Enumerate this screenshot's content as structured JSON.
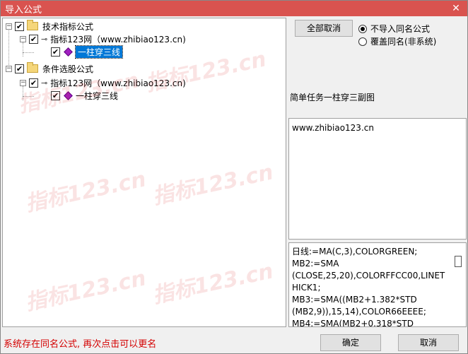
{
  "window": {
    "title": "导入公式",
    "close_glyph": "✕"
  },
  "tree": {
    "cat1": {
      "label": "技术指标公式",
      "expander": "−",
      "check": "✔"
    },
    "cat1_source": {
      "label": "指标123网（www.zhibiao123.cn)",
      "expander": "−",
      "check": "✔"
    },
    "cat1_item": {
      "label": "一柱穿三线",
      "check": "✔",
      "selected": true
    },
    "cat2": {
      "label": "条件选股公式",
      "expander": "−",
      "check": "✔"
    },
    "cat2_source": {
      "label": "指标123网（www.zhibiao123.cn)",
      "expander": "−",
      "check": "✔"
    },
    "cat2_item": {
      "label": "一柱穿三线",
      "check": "✔"
    }
  },
  "buttons": {
    "cancel_all": "全部取消",
    "ok": "确定",
    "cancel": "取消"
  },
  "options": [
    {
      "label": "不导入同名公式",
      "selected": true
    },
    {
      "label": "覆盖同名(非系统)",
      "selected": false
    }
  ],
  "description": "简单任务一柱穿三副图",
  "url_text": "www.zhibiao123.cn",
  "code_lines": [
    "日线:=MA(C,3),COLORGREEN;",
    "MB2:=SMA",
    "(CLOSE,25,20),COLORFFCC00,LINETHICK1;",
    "MB3:=SMA((MB2+1.382*STD",
    "(MB2,9)),15,14),COLOR66EEEE;",
    "MB4:=SMA(MB2+0.318*STD"
  ],
  "status_text": "系统存在同名公式, 再次点击可以更名",
  "watermark_text": "指标123.cn"
}
